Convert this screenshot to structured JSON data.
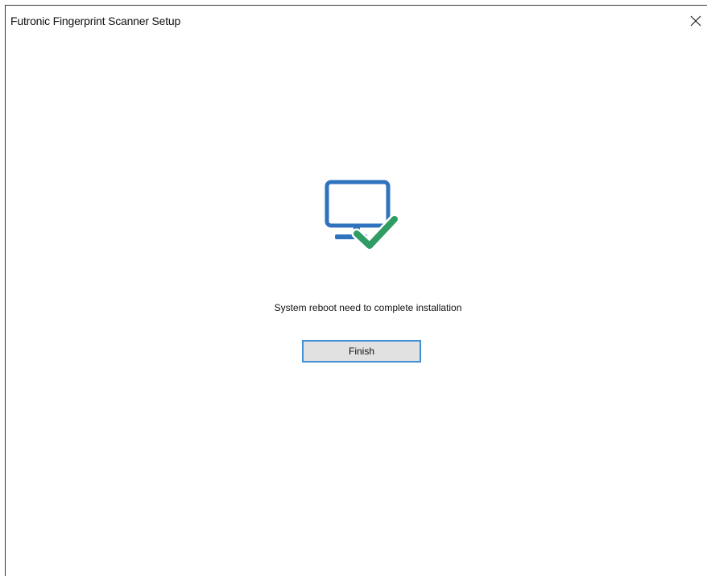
{
  "window": {
    "title": "Futronic Fingerprint Scanner Setup"
  },
  "content": {
    "message": "System reboot need to complete installation",
    "finish_label": "Finish"
  },
  "icons": {
    "close": "close-icon",
    "status": "computer-check-icon"
  },
  "colors": {
    "monitor_blue": "#2f72bd",
    "check_green": "#2e9c63",
    "button_border": "#3f8fd6",
    "button_bg": "#e1e1e1"
  }
}
